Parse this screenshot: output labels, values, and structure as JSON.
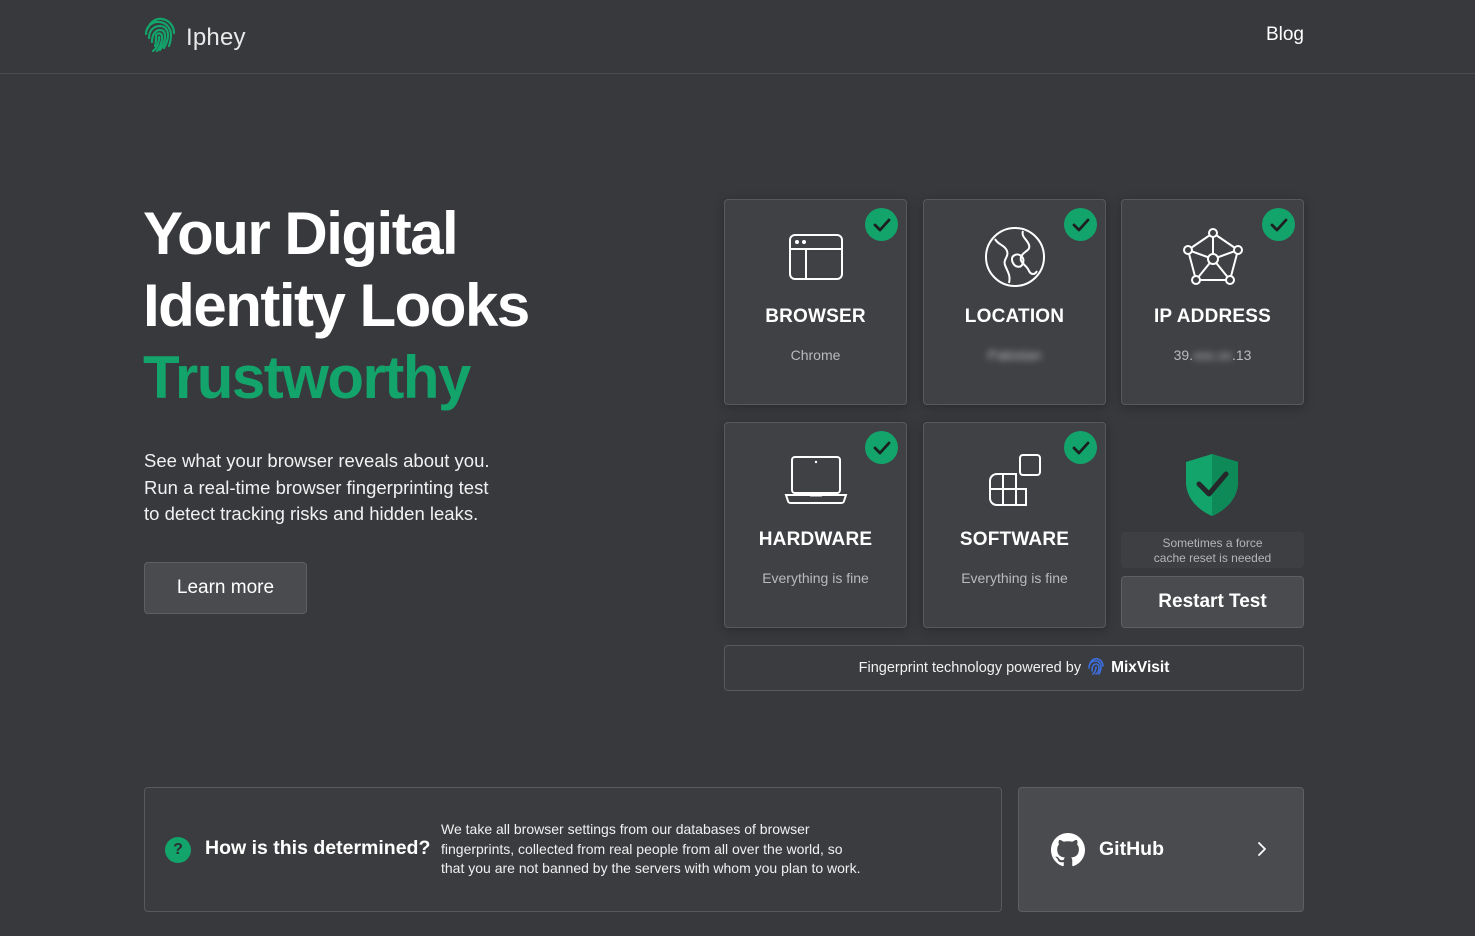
{
  "header": {
    "logo_text": "Iphey",
    "logo_icon": "fingerprint-icon",
    "blog_label": "Blog"
  },
  "hero": {
    "title_line1": "Your Digital",
    "title_line2": "Identity Looks",
    "title_accent": "Trustworthy",
    "desc_line1": "See what your browser reveals about you.",
    "desc_line2": "Run a real-time browser fingerprinting test",
    "desc_line3": "to detect tracking risks and hidden leaks.",
    "learn_more_label": "Learn more"
  },
  "cards": {
    "browser": {
      "label": "BROWSER",
      "value": "Chrome",
      "icon": "browser-window-icon",
      "status": "ok"
    },
    "location": {
      "label": "LOCATION",
      "value": "Pakistan",
      "icon": "globe-icon",
      "status": "ok"
    },
    "ip": {
      "label": "IP ADDRESS",
      "value_prefix": "39.",
      "value_hidden": "xxx.xx",
      "value_suffix": ".13",
      "icon": "network-icon",
      "status": "ok"
    },
    "hardware": {
      "label": "HARDWARE",
      "value": "Everything is fine",
      "icon": "laptop-icon",
      "status": "ok"
    },
    "software": {
      "label": "SOFTWARE",
      "value": "Everything is fine",
      "icon": "apps-icon",
      "status": "ok"
    }
  },
  "status_panel": {
    "shield_icon": "shield-check-icon",
    "cache_note_line1": "Sometimes a force",
    "cache_note_line2": "cache reset is needed",
    "restart_label": "Restart Test"
  },
  "powered": {
    "text": "Fingerprint technology powered by",
    "brand": "MixVisit"
  },
  "info": {
    "title": "How is this determined?",
    "text_line1": "We take all browser settings from our databases of browser",
    "text_line2": "fingerprints, collected from real people from all over the world, so",
    "text_line3": "that you are not banned by the servers with whom you plan to work."
  },
  "github": {
    "label": "GitHub"
  },
  "colors": {
    "accent": "#13a46b",
    "background": "#38393c",
    "card": "#404144",
    "mixvisit_blue": "#3d6fe0"
  }
}
